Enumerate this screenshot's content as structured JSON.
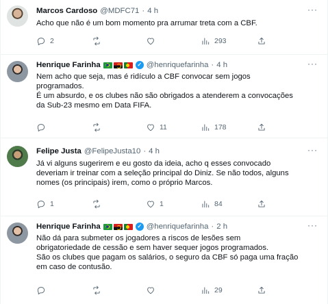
{
  "tweets": [
    {
      "name": "Marcos Cardoso",
      "handle": "@MDFC71",
      "dot": "·",
      "time": "4 h",
      "lines": [
        "Acho que não é um bom momento pra arrumar treta com a CBF."
      ],
      "replies": "2",
      "retweets": "",
      "likes": "",
      "views": "293",
      "badges": []
    },
    {
      "name": "Henrique Farinha",
      "handle": "@henriquefarinha",
      "dot": "·",
      "time": "4 h",
      "lines": [
        "Nem acho que seja, mas é ridículo a CBF convocar sem jogos",
        "programados.",
        "É um absurdo, e os clubes não são obrigados a atenderem a convocações",
        "da Sub-23 mesmo em Data FIFA."
      ],
      "replies": "",
      "retweets": "",
      "likes": "11",
      "views": "178",
      "badges": [
        "flag-brazil",
        "flag-angola",
        "flag-portugal",
        "verified-badge"
      ]
    },
    {
      "name": "Felipe Justa",
      "handle": "@FelipeJusta10",
      "dot": "·",
      "time": "4 h",
      "lines": [
        "Já vi alguns sugerirem e eu gosto da ideia, acho q esses convocado",
        "deveriam ir treinar com a seleção principal do Diniz. Se não todos, alguns",
        "nomes (os principais) irem, como o próprio Marcos."
      ],
      "replies": "1",
      "retweets": "",
      "likes": "1",
      "views": "84",
      "badges": []
    },
    {
      "name": "Henrique Farinha",
      "handle": "@henriquefarinha",
      "dot": "·",
      "time": "2 h",
      "lines": [
        "Não dá para submeter os jogadores a riscos de lesões sem",
        "obrigatoriedade de cessão e sem haver sequer jogos programados.",
        "São os clubes que pagam os salários, o seguro da CBF só paga uma fração",
        "em caso de contusão."
      ],
      "replies": "",
      "retweets": "",
      "likes": "",
      "views": "29",
      "badges": [
        "flag-brazil",
        "flag-angola",
        "flag-portugal",
        "verified-badge"
      ]
    }
  ],
  "icons": {
    "reply": "reply-icon",
    "retweet": "retweet-icon",
    "like": "like-icon",
    "views": "views-icon",
    "share": "share-icon",
    "more": "more-icon"
  },
  "more_label": "···",
  "verified_mark": "✓",
  "colors": {
    "secondary_text": "#536471",
    "verified": "#1d9bf0",
    "border": "#eff3f4"
  }
}
